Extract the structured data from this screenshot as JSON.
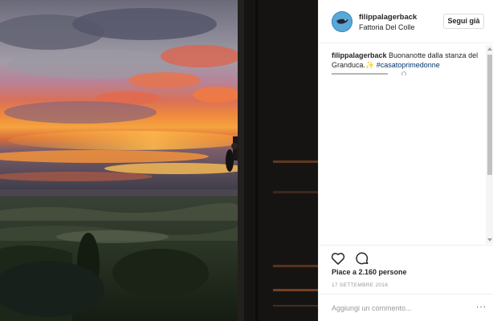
{
  "post": {
    "image_alt": "",
    "username": "filippalagerback",
    "location": "Fattoria Del Colle",
    "follow_label": "Segui già",
    "caption_user": "filippalagerback",
    "caption_text": " Buonanotte dalla stanza del Granduca.✨ ",
    "caption_hashtag": "#casatoprimedonne",
    "likes": "Piace a 2.160 persone",
    "date": "17 SETTEMBRE 2016",
    "comment_placeholder": "Aggiungi un commento...",
    "more_label": "···"
  },
  "icons": {
    "avatar": "bird-icon",
    "like": "heart-icon",
    "comment": "comment-bubble-icon",
    "more": "ellipsis-icon"
  },
  "colors": {
    "hashtag": "#003569",
    "border": "#efefef",
    "muted": "#999999",
    "text": "#262626"
  }
}
